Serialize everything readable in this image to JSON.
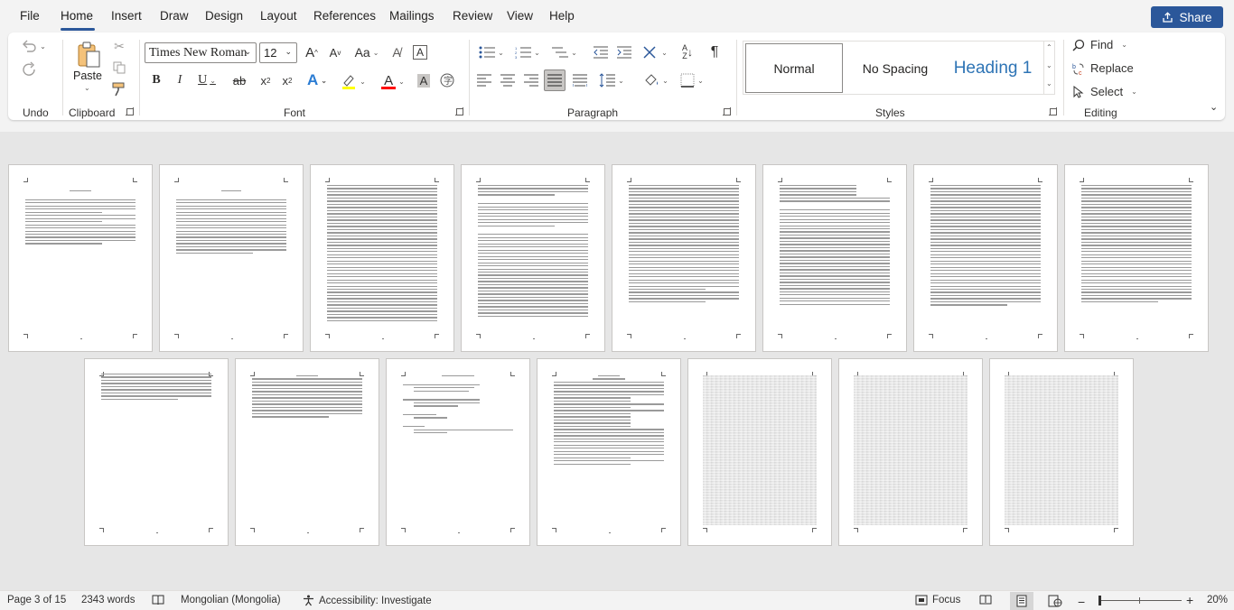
{
  "menu": {
    "items": [
      "File",
      "Home",
      "Insert",
      "Draw",
      "Design",
      "Layout",
      "References",
      "Mailings",
      "Review",
      "View",
      "Help"
    ],
    "active": "Home",
    "share_label": "Share"
  },
  "ribbon": {
    "groups": {
      "undo": "Undo",
      "clipboard": "Clipboard",
      "font": "Font",
      "paragraph": "Paragraph",
      "styles": "Styles",
      "editing": "Editing"
    },
    "paste_label": "Paste",
    "font_name": "Times New Roman",
    "font_size": "12",
    "styles": [
      "Normal",
      "No Spacing",
      "Heading 1"
    ],
    "selected_style": "Normal",
    "editing": {
      "find": "Find",
      "replace": "Replace",
      "select": "Select"
    },
    "colors": {
      "accent": "#2b579a",
      "highlight": "#ffff00",
      "font_color": "#ff0000",
      "heading": "#2e74b5"
    }
  },
  "status": {
    "page": "Page 3 of 15",
    "words": "2343 words",
    "language": "Mongolian (Mongolia)",
    "accessibility": "Accessibility: Investigate",
    "focus": "Focus",
    "zoom": "20%"
  }
}
